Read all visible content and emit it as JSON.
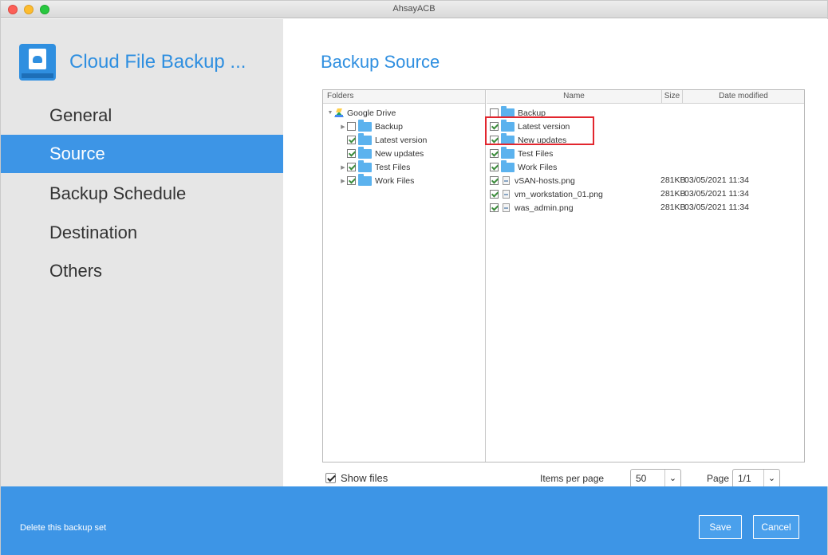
{
  "window": {
    "title": "AhsayACB"
  },
  "app": {
    "title": "Cloud File Backup ..."
  },
  "nav": [
    {
      "label": "General",
      "active": false
    },
    {
      "label": "Source",
      "active": true
    },
    {
      "label": "Backup Schedule",
      "active": false
    },
    {
      "label": "Destination",
      "active": false
    },
    {
      "label": "Others",
      "active": false
    }
  ],
  "page": {
    "title": "Backup Source"
  },
  "tree": {
    "header": "Folders",
    "root": "Google Drive",
    "items": [
      {
        "label": "Backup",
        "checked": false
      },
      {
        "label": "Latest version",
        "checked": true
      },
      {
        "label": "New updates",
        "checked": true
      },
      {
        "label": "Test Files",
        "checked": true
      },
      {
        "label": "Work Files",
        "checked": true
      }
    ]
  },
  "list": {
    "columns": {
      "name": "Name",
      "size": "Size",
      "date": "Date modified"
    },
    "rows": [
      {
        "name": "Backup",
        "type": "folder",
        "checked": false,
        "size": "",
        "date": ""
      },
      {
        "name": "Latest version",
        "type": "folder",
        "checked": true,
        "size": "",
        "date": ""
      },
      {
        "name": "New updates",
        "type": "folder",
        "checked": true,
        "size": "",
        "date": ""
      },
      {
        "name": "Test Files",
        "type": "folder",
        "checked": true,
        "size": "",
        "date": ""
      },
      {
        "name": "Work Files",
        "type": "folder",
        "checked": true,
        "size": "",
        "date": ""
      },
      {
        "name": "vSAN-hosts.png",
        "type": "file",
        "checked": true,
        "size": "281KB",
        "date": "03/05/2021 11:34"
      },
      {
        "name": "vm_workstation_01.png",
        "type": "file",
        "checked": true,
        "size": "281KB",
        "date": "03/05/2021 11:34"
      },
      {
        "name": "was_admin.png",
        "type": "file",
        "checked": true,
        "size": "281KB",
        "date": "03/05/2021 11:34"
      }
    ]
  },
  "controls": {
    "show_files_label": "Show files",
    "show_files_checked": true,
    "items_per_page_label": "Items per page",
    "items_per_page": "50",
    "page_label": "Page",
    "page_value": "1/1"
  },
  "footer": {
    "delete_label": "Delete this backup set",
    "save_label": "Save",
    "cancel_label": "Cancel"
  },
  "colors": {
    "accent": "#3d95e6",
    "title_blue": "#2f8fe0",
    "highlight": "#e2262e"
  },
  "icons": [
    "google-drive-icon",
    "folder-icon",
    "file-icon",
    "checkbox",
    "chevron-down-icon",
    "app-logo-icon"
  ]
}
